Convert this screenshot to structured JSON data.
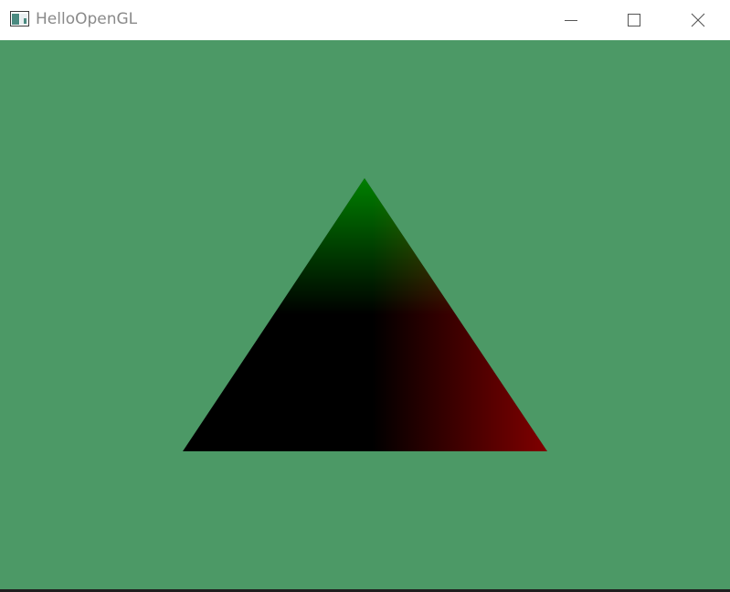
{
  "window": {
    "title": "HelloOpenGL",
    "app_icon": "window-app-icon",
    "controls": {
      "minimize_icon": "minimize-icon",
      "maximize_icon": "maximize-icon",
      "close_icon": "close-icon"
    }
  },
  "scene": {
    "clear_color": "#4c9966",
    "triangle": {
      "top_vertex_color": "#008000",
      "bottom_left_vertex_color": "#000000",
      "bottom_right_vertex_color": "#800000"
    }
  }
}
